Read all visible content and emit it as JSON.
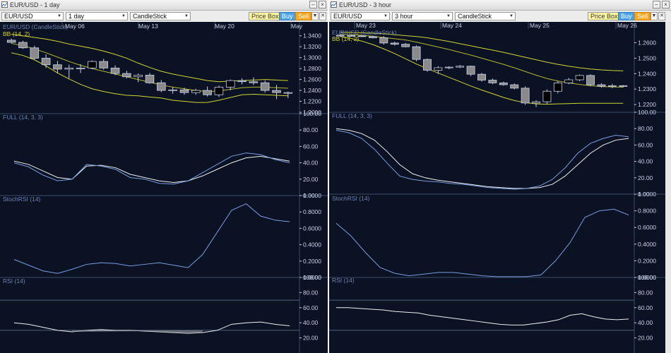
{
  "colors": {
    "bg": "#0a1224",
    "grid": "#1a2a45",
    "sep": "#3a4a66",
    "label": "#7082b0",
    "axis": "#c8d0e6",
    "yellow": "#d4d430",
    "price": "#c8d0e6",
    "white": "#f0f0f0",
    "blue": "#7c9be0"
  },
  "windows": [
    {
      "id": "left",
      "title": "EUR/USD - 1 day",
      "symbol": "EUR/USD",
      "interval": "1 day",
      "chart_type": "CandleStick",
      "buttons": {
        "price_box": "Price Box",
        "buy": "Buy",
        "sell": "Sell"
      },
      "x_labels": [
        "May 06",
        "May 13",
        "May 20",
        "May"
      ],
      "panes": {
        "price": {
          "label": "EUR/USD (CandleStick)",
          "overlay": "BB (14, 2)",
          "ticks": [
            "1.3400",
            "1.3200",
            "1.3000",
            "1.2800",
            "1.2600",
            "1.2400",
            "1.2200",
            "1.2000"
          ]
        },
        "full": {
          "label": "FULL (14, 3, 3)",
          "ticks": [
            "100.00",
            "80.00",
            "60.00",
            "40.00",
            "20.00",
            "0.00"
          ]
        },
        "stochrsi": {
          "label": "StochRSI (14)",
          "ticks": [
            "1.0000",
            "0.8000",
            "0.6000",
            "0.4000",
            "0.2000",
            "0.0000"
          ]
        },
        "rsi": {
          "label": "RSI (14)",
          "ticks": [
            "100.00",
            "80.00",
            "60.00",
            "40.00",
            "20.00"
          ]
        }
      },
      "chart_data": {
        "type": "candlestick",
        "ylim": [
          1.2,
          1.35
        ],
        "candles": [
          {
            "o": 1.332,
            "h": 1.335,
            "l": 1.326,
            "c": 1.328
          },
          {
            "o": 1.328,
            "h": 1.331,
            "l": 1.316,
            "c": 1.318
          },
          {
            "o": 1.318,
            "h": 1.322,
            "l": 1.296,
            "c": 1.299
          },
          {
            "o": 1.299,
            "h": 1.306,
            "l": 1.281,
            "c": 1.287
          },
          {
            "o": 1.287,
            "h": 1.294,
            "l": 1.271,
            "c": 1.279
          },
          {
            "o": 1.279,
            "h": 1.287,
            "l": 1.262,
            "c": 1.281
          },
          {
            "o": 1.281,
            "h": 1.288,
            "l": 1.272,
            "c": 1.281
          },
          {
            "o": 1.281,
            "h": 1.295,
            "l": 1.279,
            "c": 1.293
          },
          {
            "o": 1.293,
            "h": 1.298,
            "l": 1.278,
            "c": 1.281
          },
          {
            "o": 1.281,
            "h": 1.286,
            "l": 1.268,
            "c": 1.271
          },
          {
            "o": 1.271,
            "h": 1.276,
            "l": 1.262,
            "c": 1.265
          },
          {
            "o": 1.265,
            "h": 1.271,
            "l": 1.255,
            "c": 1.268
          },
          {
            "o": 1.268,
            "h": 1.272,
            "l": 1.252,
            "c": 1.254
          },
          {
            "o": 1.254,
            "h": 1.259,
            "l": 1.237,
            "c": 1.24
          },
          {
            "o": 1.24,
            "h": 1.246,
            "l": 1.234,
            "c": 1.241
          },
          {
            "o": 1.241,
            "h": 1.245,
            "l": 1.232,
            "c": 1.236
          },
          {
            "o": 1.236,
            "h": 1.243,
            "l": 1.232,
            "c": 1.24
          },
          {
            "o": 1.24,
            "h": 1.247,
            "l": 1.229,
            "c": 1.232
          },
          {
            "o": 1.232,
            "h": 1.249,
            "l": 1.228,
            "c": 1.246
          },
          {
            "o": 1.246,
            "h": 1.26,
            "l": 1.24,
            "c": 1.258
          },
          {
            "o": 1.258,
            "h": 1.262,
            "l": 1.251,
            "c": 1.256
          },
          {
            "o": 1.256,
            "h": 1.264,
            "l": 1.25,
            "c": 1.254
          },
          {
            "o": 1.254,
            "h": 1.258,
            "l": 1.236,
            "c": 1.24
          },
          {
            "o": 1.24,
            "h": 1.25,
            "l": 1.224,
            "c": 1.236
          },
          {
            "o": 1.236,
            "h": 1.238,
            "l": 1.226,
            "c": 1.236
          }
        ],
        "bb_upper": [
          1.343,
          1.34,
          1.337,
          1.334,
          1.33,
          1.325,
          1.321,
          1.317,
          1.312,
          1.306,
          1.299,
          1.29,
          1.282,
          1.275,
          1.27,
          1.266,
          1.262,
          1.258,
          1.256,
          1.257,
          1.258,
          1.259,
          1.26,
          1.259,
          1.258
        ],
        "bb_middle": [
          1.326,
          1.322,
          1.316,
          1.309,
          1.301,
          1.293,
          1.286,
          1.28,
          1.275,
          1.27,
          1.265,
          1.26,
          1.255,
          1.25,
          1.246,
          1.243,
          1.24,
          1.238,
          1.239,
          1.242,
          1.245,
          1.246,
          1.246,
          1.245,
          1.244
        ],
        "bb_lower": [
          1.309,
          1.304,
          1.296,
          1.285,
          1.272,
          1.261,
          1.251,
          1.243,
          1.238,
          1.234,
          1.231,
          1.23,
          1.228,
          1.226,
          1.222,
          1.22,
          1.218,
          1.218,
          1.222,
          1.227,
          1.232,
          1.233,
          1.232,
          1.231,
          1.23
        ],
        "full_k": [
          40,
          35,
          25,
          18,
          20,
          38,
          36,
          32,
          22,
          20,
          15,
          14,
          18,
          28,
          38,
          48,
          52,
          50,
          44,
          40
        ],
        "full_d": [
          42,
          38,
          30,
          22,
          20,
          36,
          37,
          34,
          26,
          22,
          18,
          16,
          18,
          24,
          32,
          40,
          46,
          48,
          45,
          42
        ],
        "stochrsi": [
          0.22,
          0.15,
          0.08,
          0.05,
          0.1,
          0.16,
          0.18,
          0.17,
          0.14,
          0.16,
          0.18,
          0.15,
          0.12,
          0.28,
          0.55,
          0.82,
          0.9,
          0.75,
          0.7,
          0.68
        ],
        "rsi": [
          40,
          38,
          34,
          30,
          28,
          30,
          31,
          30,
          30,
          29,
          28,
          27,
          26,
          27,
          30,
          38,
          40,
          41,
          38,
          36
        ]
      }
    },
    {
      "id": "right",
      "title": "EUR/USD - 3 hour",
      "symbol": "EUR/USD",
      "interval": "3 hour",
      "chart_type": "CandleStick",
      "buttons": {
        "price_box": "Price Box",
        "buy": "Buy",
        "sell": "Sell"
      },
      "x_labels": [
        "May 23",
        "May 24",
        "May 25",
        "May 26"
      ],
      "panes": {
        "price": {
          "label": "EUR/USD (CandleStick)",
          "overlay": "BB (14, 2)",
          "ticks": [
            "1.2600",
            "1.2500",
            "1.2400",
            "1.2300",
            "1.2200"
          ]
        },
        "full": {
          "label": "FULL (14, 3, 3)",
          "ticks": [
            "100.00",
            "80.00",
            "60.00",
            "40.00",
            "20.00",
            "0.00"
          ]
        },
        "stochrsi": {
          "label": "StochRSI (14)",
          "ticks": [
            "1.0000",
            "0.8000",
            "0.6000",
            "0.4000",
            "0.2000",
            "0.0000"
          ]
        },
        "rsi": {
          "label": "RSI (14)",
          "ticks": [
            "100.00",
            "80.00",
            "60.00",
            "40.00",
            "20.00"
          ]
        }
      },
      "chart_data": {
        "type": "candlestick",
        "ylim": [
          1.215,
          1.268
        ],
        "candles": [
          {
            "o": 1.2648,
            "h": 1.2655,
            "l": 1.2642,
            "c": 1.2646
          },
          {
            "o": 1.2646,
            "h": 1.2652,
            "l": 1.264,
            "c": 1.2644
          },
          {
            "o": 1.2644,
            "h": 1.265,
            "l": 1.2638,
            "c": 1.264
          },
          {
            "o": 1.264,
            "h": 1.2646,
            "l": 1.2628,
            "c": 1.2632
          },
          {
            "o": 1.2632,
            "h": 1.2642,
            "l": 1.2588,
            "c": 1.2598
          },
          {
            "o": 1.2598,
            "h": 1.2606,
            "l": 1.2582,
            "c": 1.259
          },
          {
            "o": 1.259,
            "h": 1.2598,
            "l": 1.257,
            "c": 1.2574
          },
          {
            "o": 1.2574,
            "h": 1.2582,
            "l": 1.248,
            "c": 1.2492
          },
          {
            "o": 1.2492,
            "h": 1.2498,
            "l": 1.2412,
            "c": 1.2422
          },
          {
            "o": 1.2422,
            "h": 1.2448,
            "l": 1.2398,
            "c": 1.2438
          },
          {
            "o": 1.2438,
            "h": 1.2448,
            "l": 1.2428,
            "c": 1.2442
          },
          {
            "o": 1.2442,
            "h": 1.2456,
            "l": 1.2436,
            "c": 1.2448
          },
          {
            "o": 1.2448,
            "h": 1.2452,
            "l": 1.2384,
            "c": 1.2396
          },
          {
            "o": 1.2396,
            "h": 1.2404,
            "l": 1.2348,
            "c": 1.2358
          },
          {
            "o": 1.2358,
            "h": 1.2368,
            "l": 1.2332,
            "c": 1.234
          },
          {
            "o": 1.234,
            "h": 1.2348,
            "l": 1.2322,
            "c": 1.2328
          },
          {
            "o": 1.2328,
            "h": 1.2336,
            "l": 1.2298,
            "c": 1.2306
          },
          {
            "o": 1.2306,
            "h": 1.2318,
            "l": 1.2198,
            "c": 1.221
          },
          {
            "o": 1.221,
            "h": 1.2228,
            "l": 1.2184,
            "c": 1.2218
          },
          {
            "o": 1.2218,
            "h": 1.2298,
            "l": 1.2204,
            "c": 1.2286
          },
          {
            "o": 1.2286,
            "h": 1.2352,
            "l": 1.2272,
            "c": 1.234
          },
          {
            "o": 1.234,
            "h": 1.2372,
            "l": 1.2332,
            "c": 1.236
          },
          {
            "o": 1.236,
            "h": 1.2394,
            "l": 1.2352,
            "c": 1.2388
          },
          {
            "o": 1.2388,
            "h": 1.2396,
            "l": 1.2318,
            "c": 1.2328
          },
          {
            "o": 1.2328,
            "h": 1.2338,
            "l": 1.231,
            "c": 1.2318
          },
          {
            "o": 1.2318,
            "h": 1.2334,
            "l": 1.2306,
            "c": 1.2322
          },
          {
            "o": 1.2322,
            "h": 1.2326,
            "l": 1.2312,
            "c": 1.2318
          }
        ],
        "bb_upper": [
          1.2668,
          1.2666,
          1.2664,
          1.2662,
          1.2658,
          1.2652,
          1.2646,
          1.264,
          1.2632,
          1.262,
          1.2608,
          1.2594,
          1.258,
          1.2566,
          1.2552,
          1.2538,
          1.2522,
          1.2506,
          1.249,
          1.2474,
          1.246,
          1.2448,
          1.2438,
          1.243,
          1.2424,
          1.242,
          1.2418
        ],
        "bb_middle": [
          1.2655,
          1.2652,
          1.2648,
          1.2642,
          1.2634,
          1.2626,
          1.2618,
          1.2604,
          1.2588,
          1.2572,
          1.2556,
          1.2538,
          1.252,
          1.25,
          1.248,
          1.246,
          1.2438,
          1.2414,
          1.239,
          1.2368,
          1.2352,
          1.234,
          1.233,
          1.2322,
          1.2316,
          1.2314,
          1.2312
        ],
        "bb_lower": [
          1.264,
          1.2628,
          1.261,
          1.2588,
          1.256,
          1.253,
          1.2496,
          1.2462,
          1.2432,
          1.2404,
          1.2376,
          1.2348,
          1.232,
          1.2294,
          1.227,
          1.2246,
          1.2226,
          1.2212,
          1.2204,
          1.2202,
          1.2204,
          1.2206,
          1.2208,
          1.2208,
          1.2208,
          1.2208,
          1.2208
        ],
        "full_k": [
          78,
          75,
          68,
          55,
          38,
          22,
          18,
          16,
          15,
          13,
          12,
          10,
          8,
          7,
          6,
          7,
          10,
          18,
          32,
          50,
          62,
          68,
          72,
          70
        ],
        "full_d": [
          80,
          78,
          74,
          66,
          52,
          36,
          25,
          20,
          17,
          15,
          13,
          11,
          9,
          8,
          7,
          7,
          8,
          12,
          22,
          36,
          50,
          60,
          66,
          68
        ],
        "stochrsi": [
          0.65,
          0.5,
          0.3,
          0.12,
          0.05,
          0.02,
          0.04,
          0.06,
          0.06,
          0.04,
          0.02,
          0.01,
          0.01,
          0.01,
          0.03,
          0.2,
          0.42,
          0.72,
          0.8,
          0.82,
          0.75
        ],
        "rsi": [
          60,
          60,
          59,
          58,
          57,
          55,
          54,
          53,
          50,
          48,
          46,
          44,
          42,
          40,
          38,
          37,
          37,
          39,
          41,
          44,
          50,
          52,
          48,
          45,
          44,
          45
        ]
      }
    }
  ]
}
